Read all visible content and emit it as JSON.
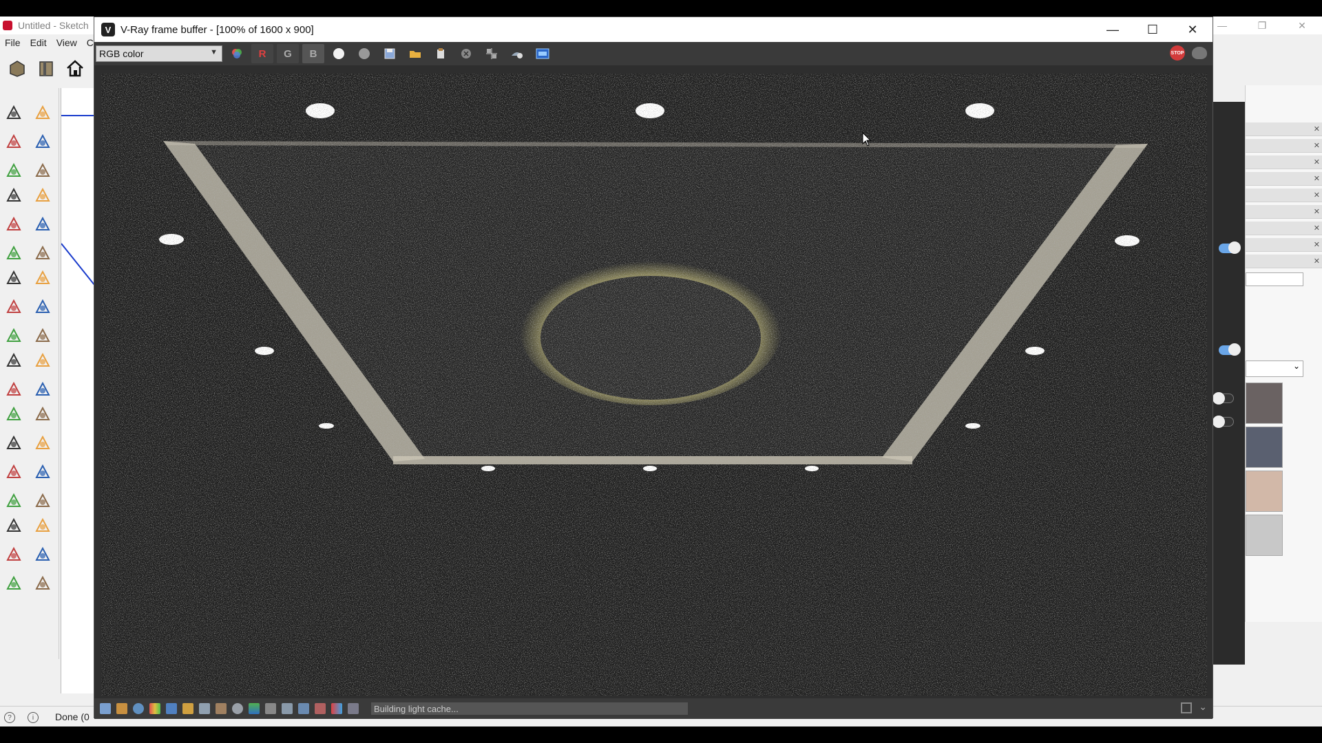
{
  "sketchup": {
    "title": "Untitled - Sketch",
    "menu": [
      "File",
      "Edit",
      "View",
      "C"
    ],
    "status_text": "Done (0"
  },
  "vfb": {
    "title": "V-Ray frame buffer - [100% of 1600 x 900]",
    "channel": "RGB color",
    "channel_buttons": [
      "R",
      "G",
      "B"
    ],
    "stop_label": "STOP",
    "progress_text": "Building light cache...",
    "render_progress": "Building light cache"
  },
  "colors": {
    "vfb_bg": "#2e2e2e",
    "render_bg": "#1d1d1d",
    "ceiling_edge": "#cfc9b8",
    "cove_glow": "#c8c07a",
    "accent_blue": "#6aa6e8",
    "stop_red": "#d23b3b"
  },
  "icons": {
    "sketchup_tools": [
      "select-icon",
      "eraser-fill-icon",
      "paint-bucket-icon",
      "eraser-icon",
      "pencil-icon",
      "freehand-icon",
      "rectangle-icon",
      "rotated-rect-icon",
      "circle-icon",
      "polygon-icon",
      "arc-icon",
      "two-point-arc-icon",
      "pie-icon",
      "three-point-arc-icon",
      "move-icon",
      "push-pull-icon",
      "rotate-icon",
      "follow-me-icon",
      "scale-icon",
      "offset-icon",
      "tape-measure-icon",
      "dimension-icon",
      "protractor-icon",
      "text-icon",
      "axes-icon",
      "3d-text-icon",
      "orbit-icon",
      "pan-icon",
      "zoom-icon",
      "zoom-window-icon",
      "zoom-extents-icon",
      "previous-view-icon",
      "position-camera-icon",
      "look-around-icon",
      "walk-icon",
      "section-plane-icon"
    ]
  }
}
